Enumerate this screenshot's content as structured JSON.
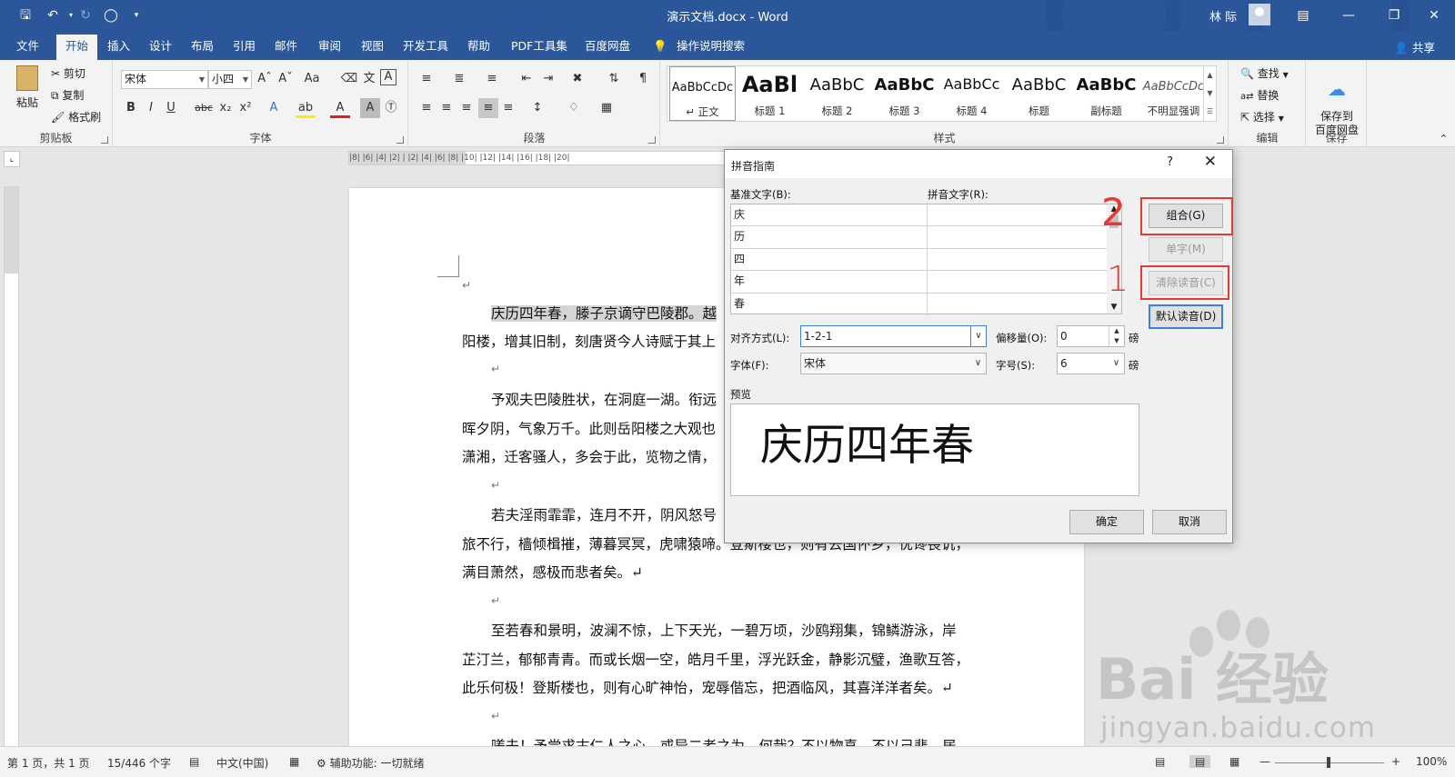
{
  "titlebar": {
    "title": "演示文档.docx  -  Word",
    "user": "林 际",
    "qa_icons": [
      "save-icon",
      "undo-icon",
      "redo-icon",
      "circle-icon",
      "customize-icon"
    ]
  },
  "tabs": [
    "文件",
    "开始",
    "插入",
    "设计",
    "布局",
    "引用",
    "邮件",
    "审阅",
    "视图",
    "开发工具",
    "帮助",
    "PDF工具集",
    "百度网盘"
  ],
  "active_tab": "开始",
  "tell_me": "操作说明搜索",
  "share": "共享",
  "ribbon": {
    "clipboard": {
      "label": "剪贴板",
      "paste": "粘贴",
      "cut": "剪切",
      "copy": "复制",
      "format_painter": "格式刷"
    },
    "font": {
      "label": "字体",
      "font_name": "宋体",
      "font_size": "小四"
    },
    "paragraph": {
      "label": "段落"
    },
    "styles": {
      "label": "样式",
      "items": [
        {
          "sample": "AaBbCcDc",
          "name": "↵ 正文"
        },
        {
          "sample": "AaBl",
          "name": "标题 1"
        },
        {
          "sample": "AaBbC",
          "name": "标题 2"
        },
        {
          "sample": "AaBbC",
          "name": "标题 3"
        },
        {
          "sample": "AaBbCc",
          "name": "标题 4"
        },
        {
          "sample": "AaBbC",
          "name": "标题"
        },
        {
          "sample": "AaBbC",
          "name": "副标题"
        },
        {
          "sample": "AaBbCcDc",
          "name": "不明显强调"
        }
      ]
    },
    "editing": {
      "label": "编辑",
      "find": "查找",
      "replace": "替换",
      "select": "选择"
    },
    "save": {
      "label": "保存",
      "button": "保存到\n百度网盘"
    }
  },
  "document": {
    "paragraphs": [
      {
        "line1": "庆历四年春，滕子京谪守巴陵郡。越",
        "line2": "阳楼，增其旧制，刻唐贤今人诗赋于其上"
      },
      {
        "line1": "予观夫巴陵胜状，在洞庭一湖。衔远",
        "line2": "晖夕阴，气象万千。此则岳阳楼之大观也",
        "line3": "潇湘，迁客骚人，多会于此，览物之情，"
      },
      {
        "line1": "若夫淫雨霏霏，连月不开，阴风怒号",
        "line2": "旅不行，樯倾楫摧，薄暮冥冥，虎啸猿啼。登斯楼也，则有去国怀乡，忧谗畏讥，",
        "line3": "满目萧然，感极而悲者矣。↵"
      },
      {
        "line1": "至若春和景明，波澜不惊，上下天光，一碧万顷，沙鸥翔集，锦鳞游泳，岸",
        "line2": "芷汀兰，郁郁青青。而或长烟一空，皓月千里，浮光跃金，静影沉璧，渔歌互答，",
        "line3": "此乐何极！登斯楼也，则有心旷神怡，宠辱偕忘，把酒临风，其喜洋洋者矣。↵"
      },
      {
        "line1": "嗟夫！予尝求古仁人之心，或异二者之为，何哉？不以物喜，不以己悲。居"
      }
    ],
    "highlight": "庆历四年春，滕子京谪守巴陵郡。",
    "return_mark": "↵"
  },
  "ruler": "|8| |6| |4| |2|  |  |2| |4| |6| |8| |10| |12| |14| |16| |18| |20|",
  "dialog": {
    "title": "拼音指南",
    "help": "?",
    "close": "✕",
    "base_label": "基准文字(B):",
    "pinyin_label": "拼音文字(R):",
    "rows": [
      {
        "base": "庆",
        "pinyin": ""
      },
      {
        "base": "历",
        "pinyin": ""
      },
      {
        "base": "四",
        "pinyin": ""
      },
      {
        "base": "年",
        "pinyin": ""
      },
      {
        "base": "春",
        "pinyin": ""
      }
    ],
    "buttons": {
      "group": "组合(G)",
      "single": "单字(M)",
      "clear": "清除读音(C)",
      "default_reading": "默认读音(D)",
      "ok": "确定",
      "cancel": "取消"
    },
    "alignment": {
      "label": "对齐方式(L):",
      "value": "1-2-1"
    },
    "offset": {
      "label": "偏移量(O):",
      "value": "0",
      "unit": "磅"
    },
    "font": {
      "label": "字体(F):",
      "value": "宋体"
    },
    "size": {
      "label": "字号(S):",
      "value": "6",
      "unit": "磅"
    },
    "preview_label": "预览",
    "preview_text": "庆历四年春",
    "annotations": [
      "2",
      "1"
    ]
  },
  "status": {
    "page": "第 1 页，共 1 页",
    "words": "15/446 个字",
    "lang": "中文(中国)",
    "accessibility": "辅助功能: 一切就绪",
    "zoom": "100%"
  },
  "watermark": {
    "brand": "Bai  经验",
    "url": "jingyan.baidu.com"
  }
}
